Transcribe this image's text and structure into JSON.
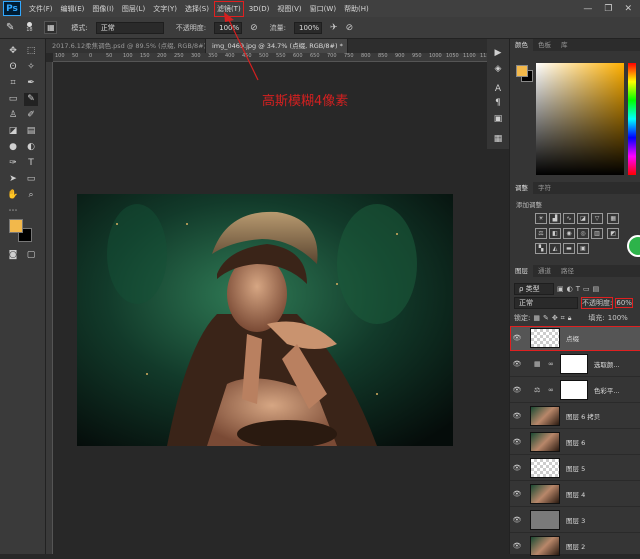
{
  "menubar": {
    "logo": "Ps",
    "items": [
      "文件(F)",
      "编辑(E)",
      "图像(I)",
      "图层(L)",
      "文字(Y)",
      "选择(S)",
      "滤镜(T)",
      "3D(D)",
      "视图(V)",
      "窗口(W)",
      "帮助(H)"
    ],
    "highlighted_index": 6,
    "window_controls": [
      "—",
      "❐",
      "✕"
    ]
  },
  "optbar": {
    "brush_size": "18",
    "mode_label": "模式:",
    "mode_value": "正常",
    "opacity_label": "不透明度:",
    "opacity_value": "100%",
    "flow_label": "流量:",
    "flow_value": "100%"
  },
  "tabs": [
    {
      "label": "2017.6.12柔焦调色.psd @ 89.5% (点缀, RGB/8#) *",
      "active": false
    },
    {
      "label": "img_0469.jpg @ 34.7% (点缀, RGB/8#) *",
      "active": true
    }
  ],
  "ruler": [
    "100",
    "50",
    "0",
    "50",
    "100",
    "150",
    "200",
    "250",
    "300",
    "350",
    "400",
    "450",
    "500",
    "550",
    "600",
    "650",
    "700",
    "750",
    "800",
    "850",
    "900",
    "950",
    "1000",
    "1050",
    "1100",
    "1150",
    "1200"
  ],
  "annotation": "高斯模糊4像素",
  "right": {
    "color_tabs": [
      "颜色",
      "色板",
      "库"
    ],
    "adjust_tabs": [
      "调整",
      "字符"
    ],
    "adjust_add_label": "添加调整",
    "layer_tabs": [
      "图层",
      "通道",
      "路径"
    ],
    "kind_label": "ρ 类型",
    "blend_mode": "正常",
    "opacity_label": "不透明度:",
    "opacity_value": "60%",
    "lock_label": "锁定:",
    "fill_label": "填充:",
    "fill_value": "100%",
    "layers": [
      {
        "name": "点缀",
        "type": "transparent",
        "selected": true
      },
      {
        "name": "选取颜...",
        "type": "adjust"
      },
      {
        "name": "色彩平...",
        "type": "adjust"
      },
      {
        "name": "图层 6 拷贝",
        "type": "photo"
      },
      {
        "name": "图层 6",
        "type": "photo"
      },
      {
        "name": "图层 5",
        "type": "transparent"
      },
      {
        "name": "图层 4",
        "type": "photo"
      },
      {
        "name": "图层 3",
        "type": "gray"
      },
      {
        "name": "图层 2",
        "type": "photo"
      }
    ]
  },
  "colors": {
    "foreground": "#f2b84b",
    "background": "#000000",
    "accent_red": "#d42020"
  }
}
